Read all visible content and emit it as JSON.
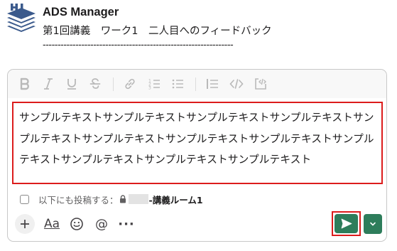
{
  "message": {
    "sender_name": "ADS Manager",
    "body_line": "第1回講義　ワーク1　二人目へのフィードバック",
    "divider": "----------------------------------------------------------------"
  },
  "composer": {
    "toolbar_icons": [
      "bold-icon",
      "italic-icon",
      "underline-icon",
      "strikethrough-icon",
      "link-icon",
      "ordered-list-icon",
      "bulleted-list-icon",
      "blockquote-icon",
      "code-icon",
      "code-block-icon"
    ],
    "draft_text": "サンプルテキストサンプルテキストサンプルテキストサンプルテキストサンプルテキストサンプルテキストサンプルテキストサンプルテキストサンプルテキストサンプルテキストサンプルテキストサンプルテキスト",
    "also_send_label": "以下にも投稿する：",
    "channel_suffix": "-講義ルーム1",
    "bottom_actions": [
      "plus-icon",
      "formatting-icon",
      "emoji-icon",
      "mention-icon",
      "more-icon"
    ],
    "aa_label": "Aa",
    "mention_label": "@",
    "more_label": "···"
  },
  "colors": {
    "send_button": "#2e7d5b",
    "highlight_border": "#dc1c1c",
    "logo": "#3b5a8c"
  }
}
